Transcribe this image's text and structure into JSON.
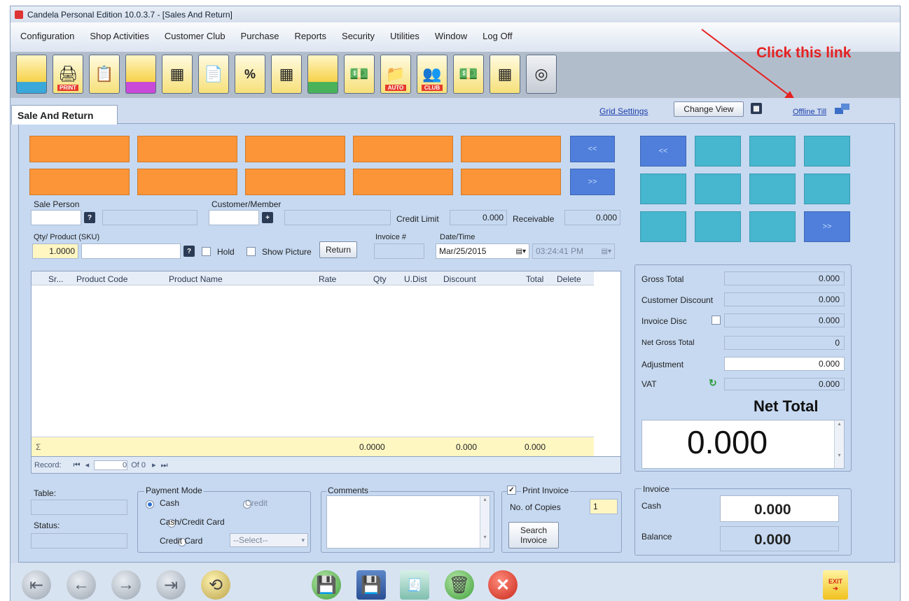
{
  "window": {
    "title": "Candela Personal Edition 10.0.3.7 - [Sales And Return]"
  },
  "menu": [
    "Configuration",
    "Shop Activities",
    "Customer Club",
    "Purchase",
    "Reports",
    "Security",
    "Utilities",
    "Window",
    "Log Off"
  ],
  "annotation": "Click this link",
  "toolbar": {
    "print_label": "PRINT",
    "auto_label": "AUTO",
    "club_label": "CLUB"
  },
  "tab": {
    "title": "Sale And Return"
  },
  "top_links": {
    "grid_settings": "Grid Settings",
    "change_view": "Change View",
    "offline_till": "Offline Till"
  },
  "nav": {
    "prev": "<<",
    "next": ">>"
  },
  "form": {
    "sale_person_label": "Sale Person",
    "customer_label": "Customer/Member",
    "credit_limit_label": "Credit Limit",
    "credit_limit_value": "0.000",
    "receivable_label": "Receivable",
    "receivable_value": "0.000",
    "qty_product_label": "Qty/ Product (SKU)",
    "qty_value": "1.0000",
    "hold_label": "Hold",
    "show_picture_label": "Show Picture",
    "return_label": "Return",
    "invoice_label": "Invoice #",
    "datetime_label": "Date/Time",
    "date_value": "Mar/25/2015",
    "time_value": "03:24:41 PM"
  },
  "grid": {
    "columns": [
      "Sr...",
      "Product Code",
      "Product Name",
      "Rate",
      "Qty",
      "U.Dist",
      "Discount",
      "Total",
      "Delete"
    ],
    "footer": {
      "sigma": "Σ",
      "qty_total": "0.0000",
      "discount_total": "0.000",
      "total": "0.000"
    },
    "record_label": "Record:",
    "record_position": "0",
    "record_of": "Of 0"
  },
  "summary": {
    "gross_total_label": "Gross Total",
    "gross_total": "0.000",
    "customer_discount_label": "Customer Discount",
    "customer_discount": "0.000",
    "invoice_disc_label": "Invoice Disc",
    "invoice_disc": "0.000",
    "net_gross_total_label": "Net Gross Total",
    "net_gross_total": "0",
    "adjustment_label": "Adjustment",
    "adjustment": "0.000",
    "vat_label": "VAT",
    "vat": "0.000",
    "net_total_label": "Net Total",
    "net_total": "0.000"
  },
  "bottom": {
    "table_label": "Table:",
    "status_label": "Status:",
    "payment_mode_label": "Payment Mode",
    "cash_label": "Cash",
    "credit_label": "Credit",
    "cash_credit_card_label": "Cash/Credit Card",
    "credit_card_label": "Credit Card",
    "select_placeholder": "--Select--",
    "comments_label": "Comments",
    "print_invoice_label": "Print Invoice",
    "copies_label": "No. of Copies",
    "copies_value": "1",
    "search_invoice_label": "Search Invoice",
    "invoice_group_label": "Invoice",
    "invoice_cash_label": "Cash",
    "invoice_cash_value": "0.000",
    "balance_label": "Balance",
    "balance_value": "0.000"
  },
  "exit_label": "EXIT"
}
